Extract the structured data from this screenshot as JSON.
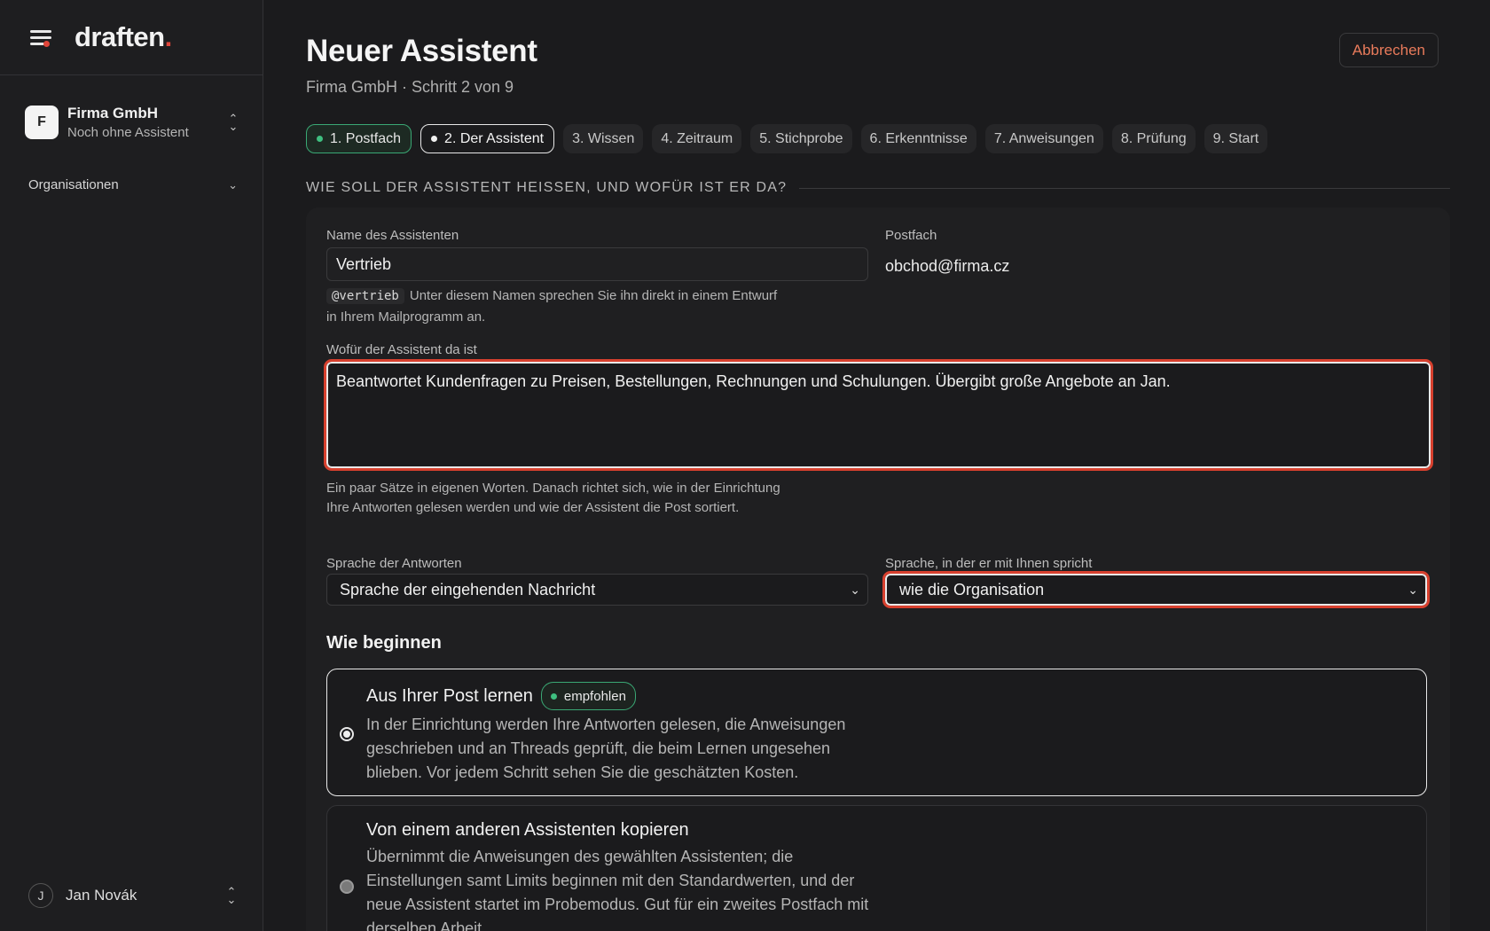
{
  "app": {
    "logo_text": "draften",
    "logo_dot": ".",
    "accent_color": "#e0453a"
  },
  "sidebar": {
    "org": {
      "avatar_letter": "F",
      "name": "Firma GmbH",
      "subtitle": "Noch ohne Assistent"
    },
    "section_label": "Organisationen",
    "user": {
      "avatar_letter": "J",
      "name": "Jan Novák"
    }
  },
  "header": {
    "title": "Neuer Assistent",
    "subtitle": "Firma GmbH · Schritt 2 von 9",
    "cancel_label": "Abbrechen"
  },
  "steps": [
    {
      "label": "1. Postfach",
      "state": "done"
    },
    {
      "label": "2. Der Assistent",
      "state": "current"
    },
    {
      "label": "3. Wissen",
      "state": "todo"
    },
    {
      "label": "4. Zeitraum",
      "state": "todo"
    },
    {
      "label": "5. Stichprobe",
      "state": "todo"
    },
    {
      "label": "6. Erkenntnisse",
      "state": "todo"
    },
    {
      "label": "7. Anweisungen",
      "state": "todo"
    },
    {
      "label": "8. Prüfung",
      "state": "todo"
    },
    {
      "label": "9. Start",
      "state": "todo"
    }
  ],
  "form": {
    "section_heading": "WIE SOLL DER ASSISTENT HEISSEN, UND WOFÜR IST ER DA?",
    "name_label": "Name des Assistenten",
    "name_value": "Vertrieb",
    "handle_code": "@vertrieb",
    "handle_hint": "Unter diesem Namen sprechen Sie ihn direkt in einem Entwurf in Ihrem Mailprogramm an.",
    "mailbox_label": "Postfach",
    "mailbox_value": "obchod@firma.cz",
    "purpose_label": "Wofür der Assistent da ist",
    "purpose_value": "Beantwortet Kundenfragen zu Preisen, Bestellungen, Rechnungen und Schulungen. Übergibt große Angebote an Jan.",
    "purpose_hint": "Ein paar Sätze in eigenen Worten. Danach richtet sich, wie in der Einrichtung Ihre Antworten gelesen werden und wie der Assistent die Post sortiert.",
    "reply_lang_label": "Sprache der Antworten",
    "reply_lang_value": "Sprache der eingehenden Nachricht",
    "talk_lang_label": "Sprache, in der er mit Ihnen spricht",
    "talk_lang_value": "wie die Organisation",
    "begin_heading": "Wie beginnen",
    "options": [
      {
        "title": "Aus Ihrer Post lernen",
        "badge": "empfohlen",
        "desc": "In der Einrichtung werden Ihre Antworten gelesen, die Anweisungen geschrieben und an Threads geprüft, die beim Lernen ungesehen blieben. Vor jedem Schritt sehen Sie die geschätzten Kosten.",
        "selected": true
      },
      {
        "title": "Von einem anderen Assistenten kopieren",
        "desc": "Übernimmt die Anweisungen des gewählten Assistenten; die Einstellungen samt Limits beginnen mit den Standardwerten, und der neue Assistent startet im Probemodus. Gut für ein zweites Postfach mit derselben Arbeit.",
        "selected": false
      }
    ]
  }
}
